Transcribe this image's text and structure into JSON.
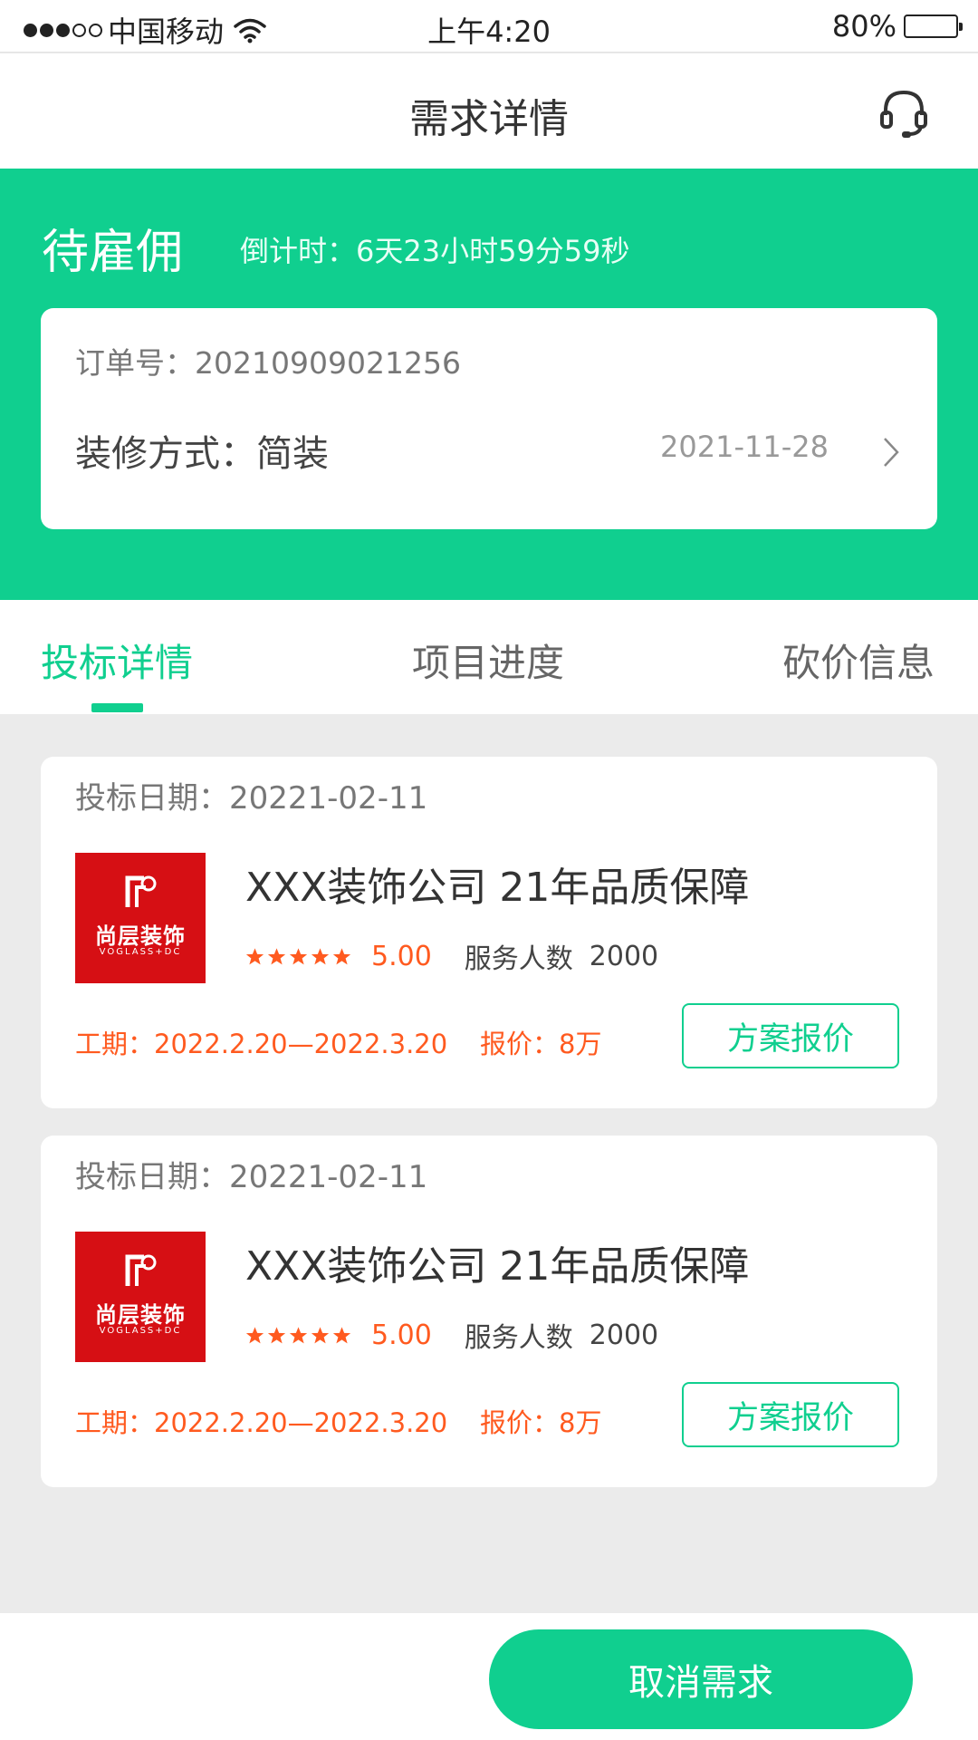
{
  "status_bar": {
    "carrier": "中国移动",
    "time": "上午4:20",
    "battery_text": "80%",
    "battery_level": 0.8
  },
  "nav": {
    "title": "需求详情",
    "service_icon": "headset-icon"
  },
  "hero": {
    "status": "待雇佣",
    "countdown": "倒计时：6天23小时59分59秒",
    "order_no_label": "订单号：",
    "order_no": "20210909021256",
    "decoration_label": "装修方式：",
    "decoration_value": "简装",
    "date": "2021-11-28"
  },
  "tabs": [
    {
      "label": "投标详情",
      "active": true
    },
    {
      "label": "项目进度",
      "active": false
    },
    {
      "label": "砍价信息",
      "active": false
    }
  ],
  "bids": [
    {
      "date_label": "投标日期：",
      "date": "20221-02-11",
      "logo_cn": "尚层装饰",
      "logo_en": "VOGLASS+DC",
      "company": "XXX装饰公司   21年品质保障",
      "rating": 5,
      "score": "5.00",
      "served_label": "服务人数",
      "served": "2000",
      "period": "工期：2022.2.20—2022.3.20",
      "price": "报价：8万",
      "button": "方案报价"
    },
    {
      "date_label": "投标日期：",
      "date": "20221-02-11",
      "logo_cn": "尚层装饰",
      "logo_en": "VOGLASS+DC",
      "company": "XXX装饰公司   21年品质保障",
      "rating": 5,
      "score": "5.00",
      "served_label": "服务人数",
      "served": "2000",
      "period": "工期：2022.2.20—2022.3.20",
      "price": "报价：8万",
      "button": "方案报价"
    }
  ],
  "bottom": {
    "cancel_label": "取消需求"
  },
  "colors": {
    "brand_green": "#10cf8f",
    "accent_orange": "#ff5a1f",
    "logo_red": "#d60f14"
  }
}
